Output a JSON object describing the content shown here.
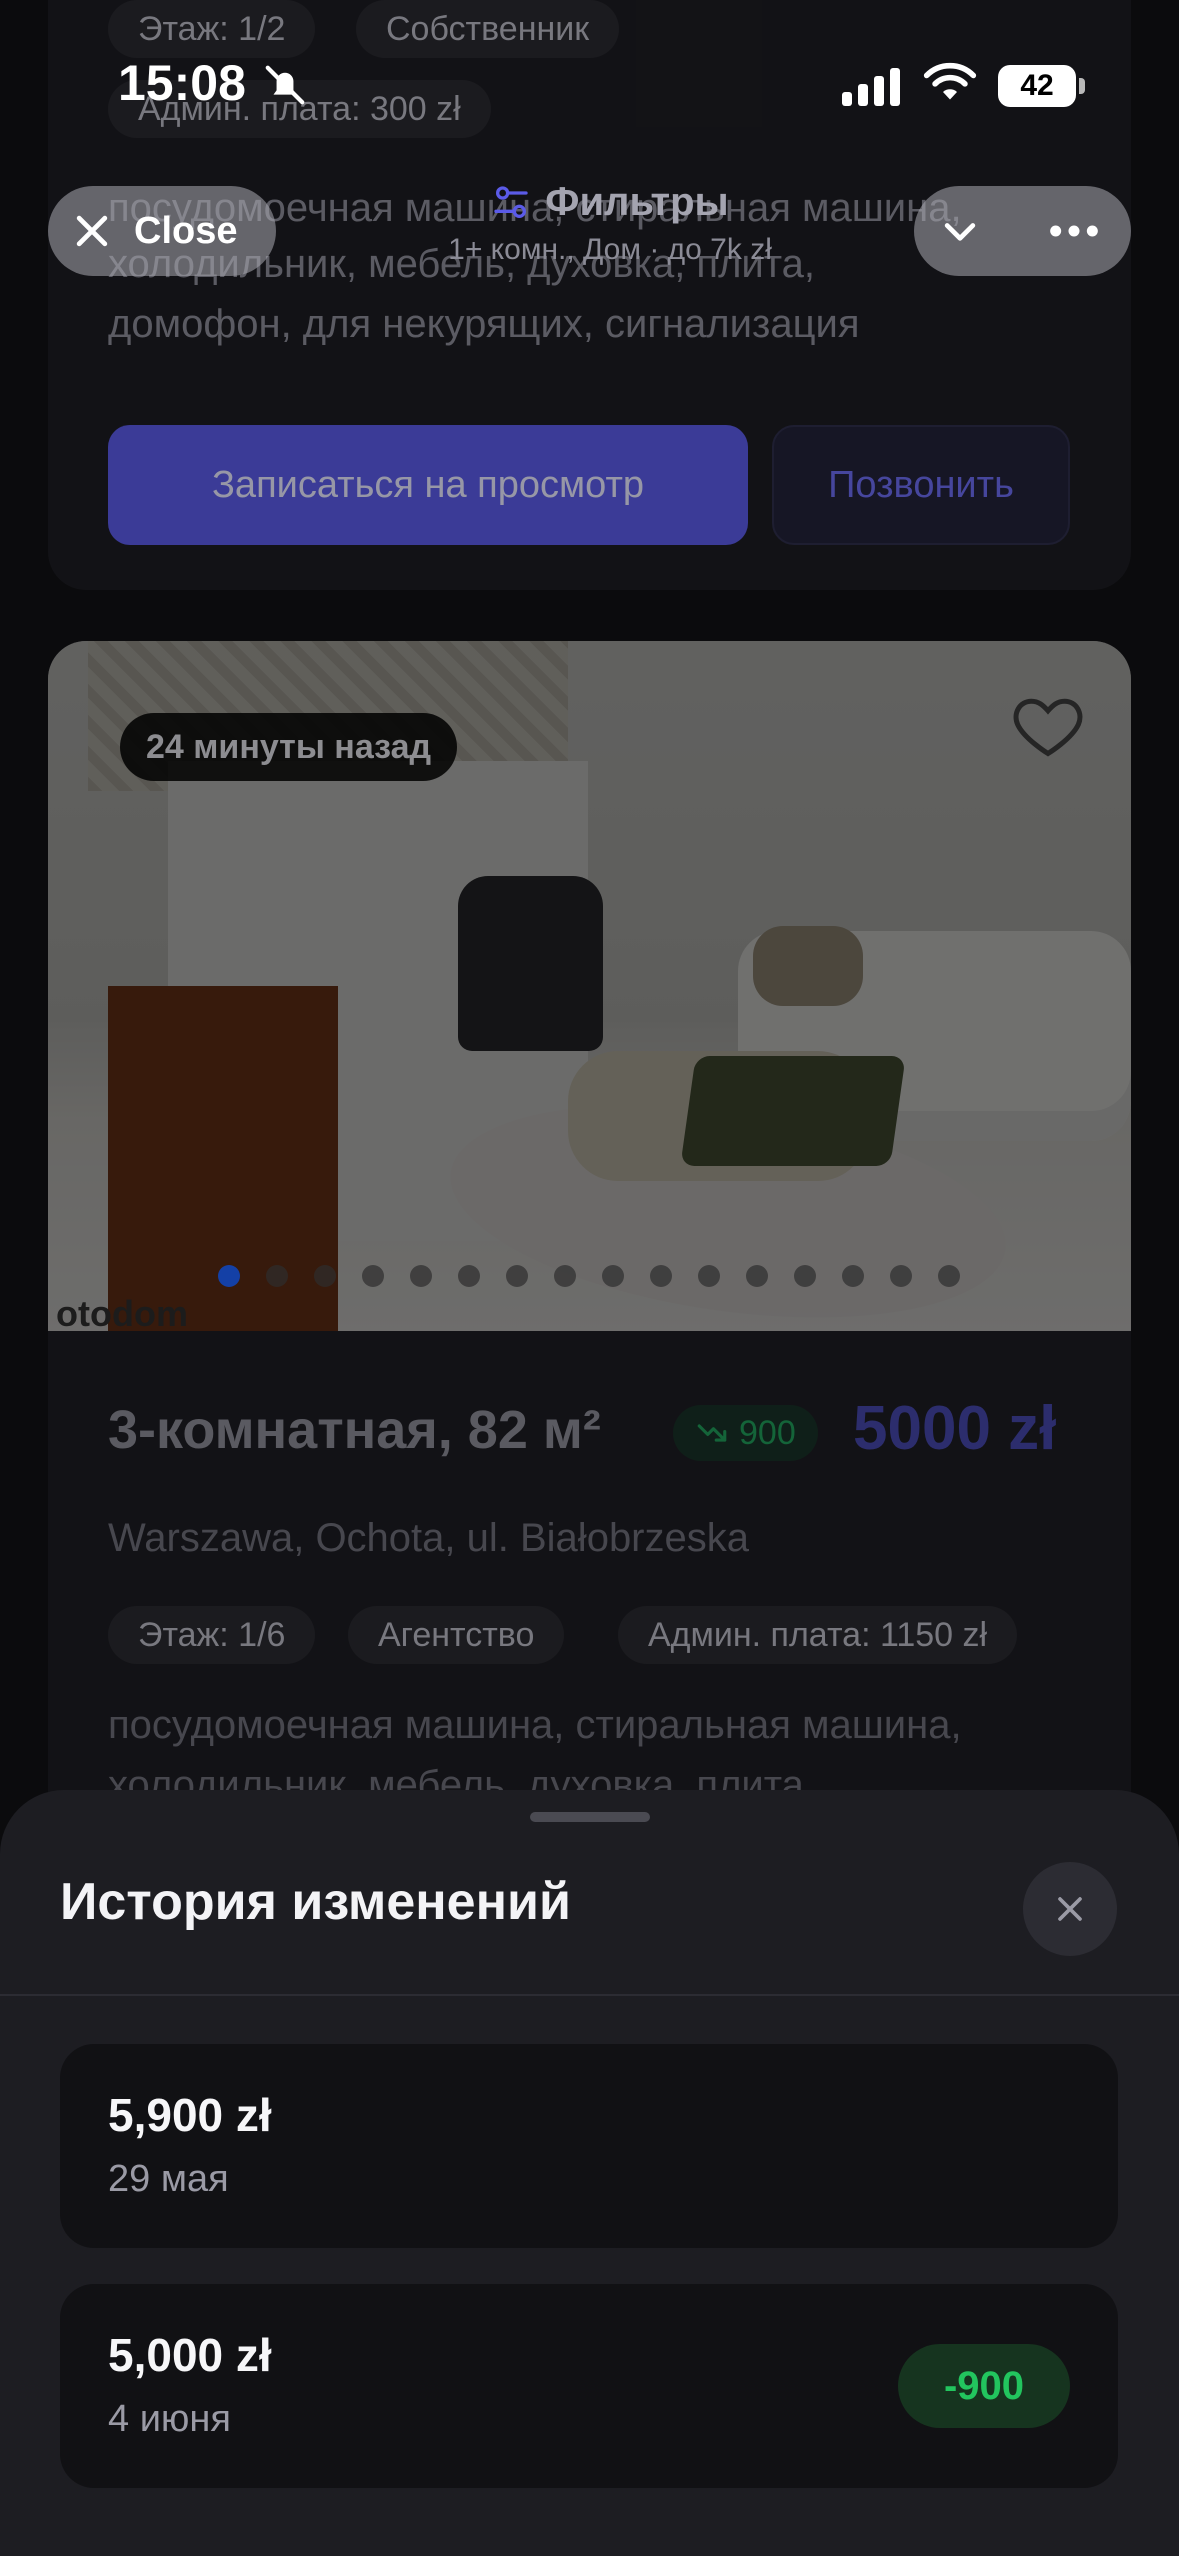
{
  "status_bar": {
    "time": "15:08",
    "battery": "42"
  },
  "header": {
    "close_label": "Close",
    "filters_title": "Фильтры",
    "filters_summary": "1+ комн., Дом · до 7k zł"
  },
  "listing_prev": {
    "chips_top": [
      "Этаж: 1/2",
      "Собственник"
    ],
    "admin_fee": "Админ. плата: 300 zł",
    "desc_line1": "посудомоечная машина, стиральная машина,",
    "desc_line2": "холодильник, мебель, духовка, плита,",
    "desc_line3": "домофон, для некурящих, сигнализация",
    "book_label": "Записаться на просмотр",
    "call_label": "Позвонить"
  },
  "listing": {
    "posted": "24 минуты назад",
    "photo_count": 16,
    "active_photo": 1,
    "watermark": "otodom",
    "title": "3-комнатная, 82 м²",
    "price_drop": "900",
    "price": "5000 zł",
    "address": "Warszawa, Ochota, ul. Białobrzeska",
    "chips": [
      "Этаж: 1/6",
      "Агентство",
      "Админ. плата: 1150 zł"
    ],
    "desc_line1": "посудомоечная машина, стиральная машина,",
    "desc_line2": "холодильник, мебель, духовка, плита,"
  },
  "sheet": {
    "title": "История изменений",
    "items": [
      {
        "price": "5,900 zł",
        "date": "29 мая",
        "delta": ""
      },
      {
        "price": "5,000 zł",
        "date": "4 июня",
        "delta": "-900"
      }
    ]
  },
  "colors": {
    "accent": "#5b5be8",
    "price_accent": "#4446a8",
    "positive_green": "#22c55e",
    "sheet_bg": "#1d1d22",
    "item_bg": "#111114"
  },
  "icons": [
    "bell-slash-icon",
    "signal-icon",
    "wifi-icon",
    "close-icon",
    "filter-sliders-icon",
    "chevron-down-icon",
    "more-icon",
    "heart-icon",
    "trend-down-icon"
  ]
}
